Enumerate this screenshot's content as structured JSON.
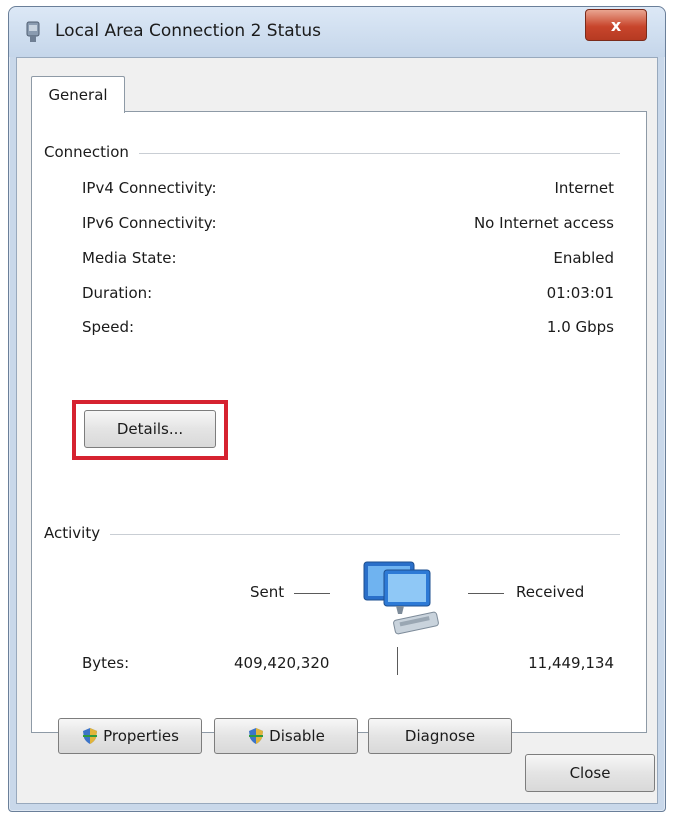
{
  "window": {
    "title": "Local Area Connection 2 Status",
    "close_label": "x"
  },
  "tabs": [
    {
      "label": "General"
    }
  ],
  "connection": {
    "heading": "Connection",
    "rows": [
      {
        "label": "IPv4 Connectivity:",
        "value": "Internet"
      },
      {
        "label": "IPv6 Connectivity:",
        "value": "No Internet access"
      },
      {
        "label": "Media State:",
        "value": "Enabled"
      },
      {
        "label": "Duration:",
        "value": "01:03:01"
      },
      {
        "label": "Speed:",
        "value": "1.0 Gbps"
      }
    ],
    "details_label": "Details..."
  },
  "activity": {
    "heading": "Activity",
    "sent_label": "Sent",
    "received_label": "Received",
    "bytes_label": "Bytes:",
    "bytes_sent": "409,420,320",
    "bytes_received": "11,449,134"
  },
  "buttons": {
    "properties": "Properties",
    "disable": "Disable",
    "diagnose": "Diagnose",
    "close": "Close"
  },
  "colors": {
    "highlight": "#d62230",
    "title_bar": "#dce8f6",
    "close_button": "#c8452c"
  },
  "icons": {
    "title": "network-adapter-icon",
    "activity": "network-computers-icon",
    "shield": "uac-shield-icon"
  }
}
